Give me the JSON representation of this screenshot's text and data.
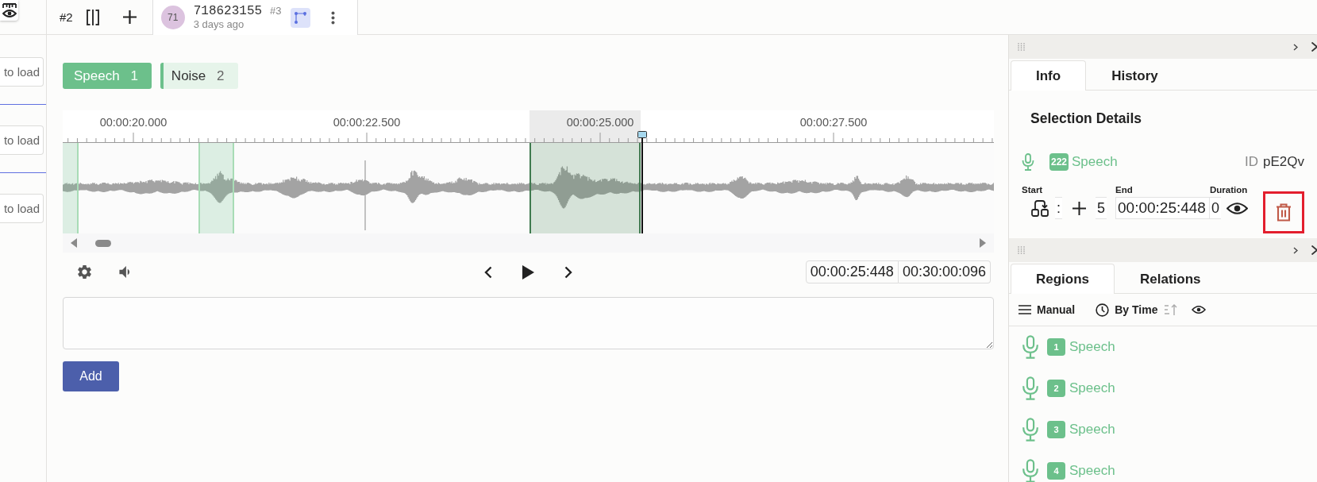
{
  "sidebar": {
    "items": [
      {
        "text": "to load"
      },
      {
        "text": "to load"
      },
      {
        "text": "to load"
      }
    ]
  },
  "top_bar": {
    "tabs": [
      {
        "kind": "compact",
        "label": "#2",
        "selected": false
      },
      {
        "kind": "annotation",
        "avatar": "71",
        "title": "718623155",
        "number": "#3",
        "subtitle": "3 days ago",
        "selected": true
      }
    ]
  },
  "labels": [
    {
      "text": "Speech",
      "hotkey": "1",
      "selected": true
    },
    {
      "text": "Noise",
      "hotkey": "2",
      "selected": false
    }
  ],
  "waveform": {
    "timeline": [
      "00:00:20.000",
      "00:00:22.500",
      "00:00:25.000",
      "00:00:27.500"
    ],
    "regions": [
      {
        "selected": false
      },
      {
        "selected": false
      },
      {
        "selected": true
      }
    ]
  },
  "player": {
    "current_time": "00:00:25:448",
    "total_time": "00:30:00:096"
  },
  "add_button": "Add",
  "details_panel": {
    "tabs": [
      {
        "label": "Info",
        "selected": true
      },
      {
        "label": "History",
        "selected": false
      }
    ],
    "heading": "Selection Details",
    "region": {
      "index": "222",
      "label": "Speech",
      "id_label": "ID",
      "id": "pE2Qv"
    },
    "timing": {
      "start": {
        "label": "Start",
        "fragments": [
          ":",
          "5"
        ]
      },
      "end": {
        "label": "End",
        "value": "00:00:25:448"
      },
      "duration": {
        "label": "Duration",
        "fragment": "0"
      }
    },
    "delete_highlighted": true
  },
  "regions_panel": {
    "tabs": [
      {
        "label": "Regions",
        "selected": true
      },
      {
        "label": "Relations",
        "selected": false
      }
    ],
    "toolbar": {
      "order": "Manual",
      "sort": "By Time"
    },
    "items": [
      {
        "index": "1",
        "label": "Speech"
      },
      {
        "index": "2",
        "label": "Speech"
      },
      {
        "index": "3",
        "label": "Speech"
      },
      {
        "index": "4",
        "label": "Speech"
      }
    ]
  }
}
